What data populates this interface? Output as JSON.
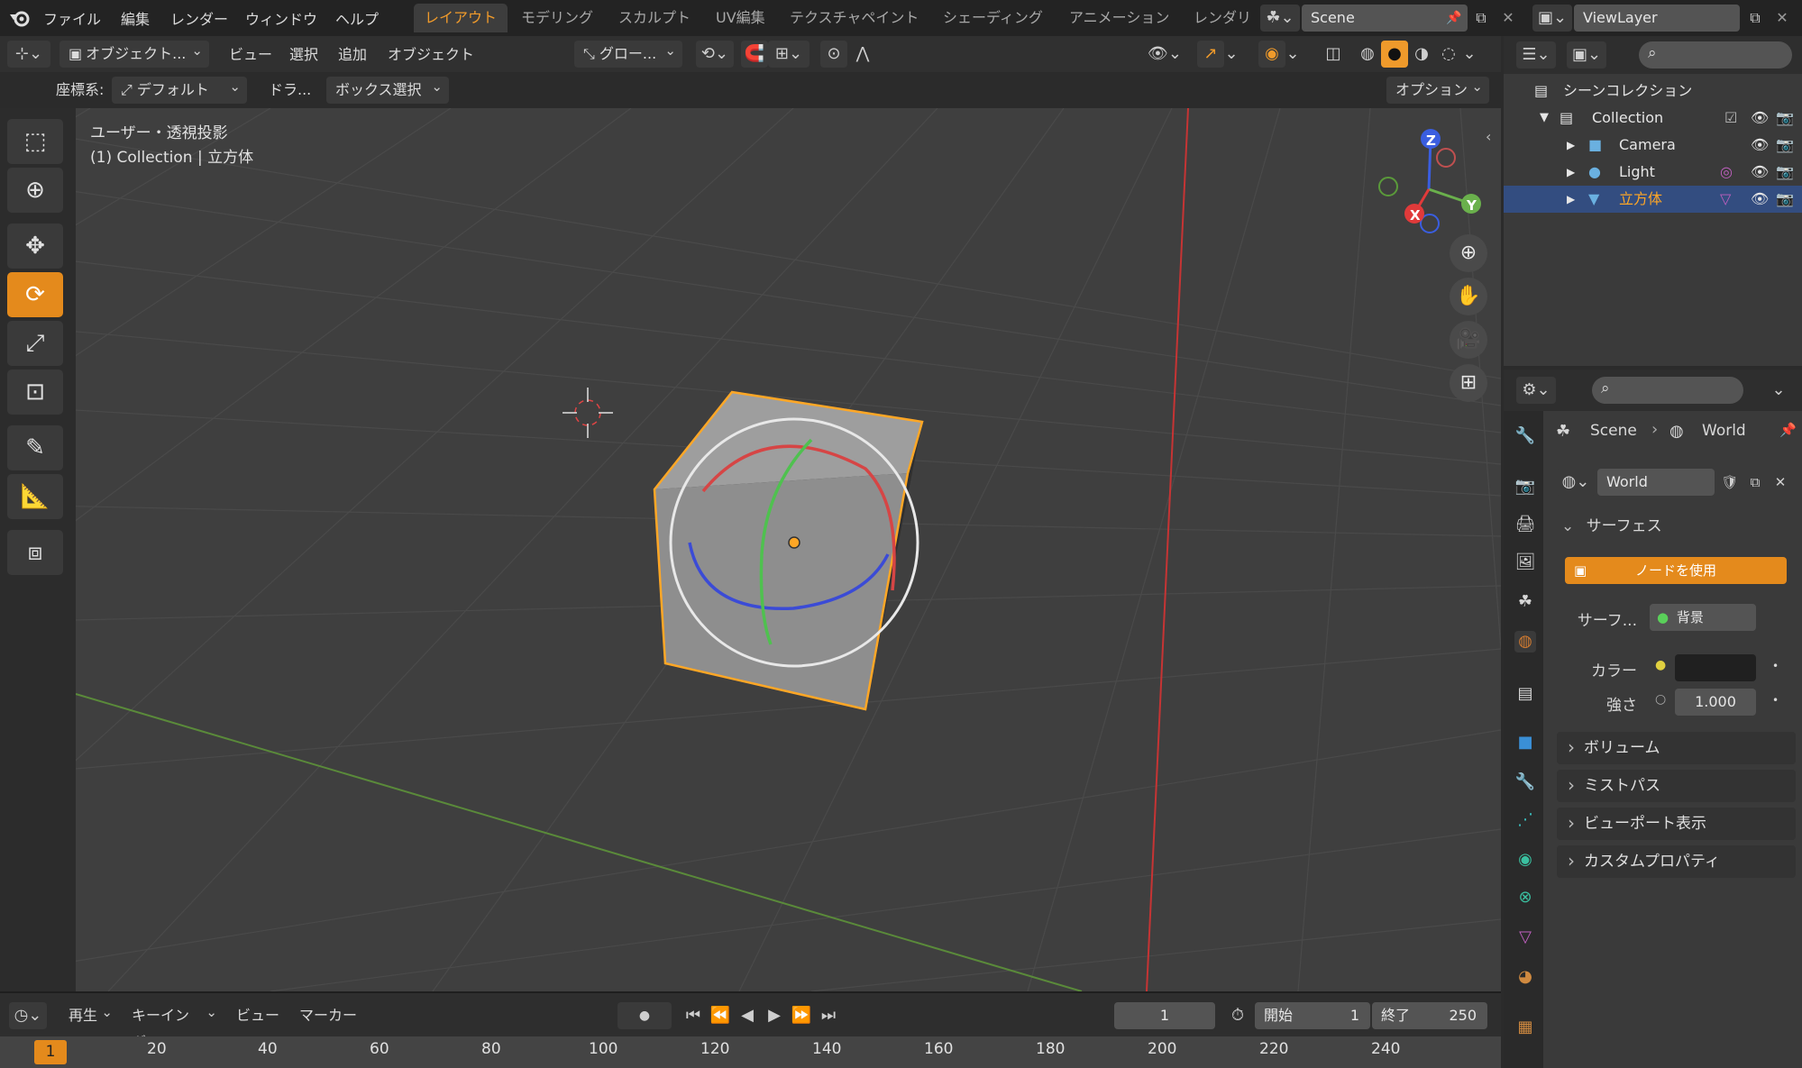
{
  "topbar": {
    "menus": [
      "ファイル",
      "編集",
      "レンダー",
      "ウィンドウ",
      "ヘルプ"
    ],
    "workspaces": [
      "レイアウト",
      "モデリング",
      "スカルプト",
      "UV編集",
      "テクスチャペイント",
      "シェーディング",
      "アニメーション",
      "レンダリ"
    ],
    "scene_name": "Scene",
    "view_layer": "ViewLayer"
  },
  "header": {
    "mode": "オブジェクト...",
    "menus": [
      "ビュー",
      "選択",
      "追加",
      "オブジェクト"
    ],
    "transform_orientation": "グロー...",
    "coord_label": "座標系:",
    "coord_value": "デフォルト",
    "drag_label": "ドラ...",
    "select_mode": "ボックス選択",
    "options": "オプション"
  },
  "viewport": {
    "view_name": "ユーザー・透視投影",
    "object_info": "(1) Collection | 立方体",
    "gizmo": {
      "x": "X",
      "y": "Y",
      "z": "Z"
    }
  },
  "outliner": {
    "root": "シーンコレクション",
    "collection": "Collection",
    "items": [
      {
        "name": "Camera",
        "selected": false
      },
      {
        "name": "Light",
        "selected": false
      },
      {
        "name": "立方体",
        "selected": true
      }
    ]
  },
  "properties": {
    "breadcrumb_scene": "Scene",
    "breadcrumb_world": "World",
    "world_name": "World",
    "surface_section": "サーフェス",
    "use_nodes": "ノードを使用",
    "surface_label": "サーフ...",
    "surface_value": "背景",
    "color_label": "カラー",
    "strength_label": "強さ",
    "strength_value": "1.000",
    "panels": [
      "ボリューム",
      "ミストパス",
      "ビューポート表示",
      "カスタムプロパティ"
    ]
  },
  "timeline": {
    "menus": [
      "再生",
      "キーイング",
      "ビュー",
      "マーカー"
    ],
    "current_frame": "1",
    "start_label": "開始",
    "start_value": "1",
    "end_label": "終了",
    "end_value": "250",
    "ruler_current": "1",
    "ruler_ticks": [
      "20",
      "40",
      "60",
      "80",
      "100",
      "120",
      "140",
      "160",
      "180",
      "200",
      "220",
      "240"
    ]
  },
  "colors": {
    "accent": "#ef9a2b",
    "selection": "#ffa726",
    "x_axis": "#e03a3a",
    "y_axis": "#6ab04c",
    "z_axis": "#3a5ee0"
  }
}
